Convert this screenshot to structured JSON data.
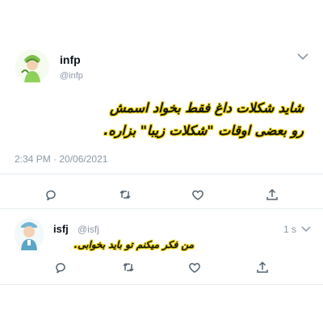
{
  "main_tweet": {
    "display_name": "infp",
    "handle": "@infp",
    "text_line1": "شاید شکلات داغ فقط بخواد اسمش",
    "text_line2": "رو بعضی اوقات \"شکلات زیبا\" بزاره.",
    "timestamp": "2:34 PM · 20/06/2021",
    "actions": [
      "reply-icon",
      "retweet-icon",
      "like-icon",
      "share-icon"
    ]
  },
  "reply_tweet": {
    "display_name": "isfj",
    "handle": "@isfj",
    "time_ago": "1 s",
    "text": "من فکر میکنم تو باید بخوابی.",
    "actions": [
      "reply-icon",
      "retweet-icon",
      "like-icon",
      "share-icon"
    ]
  },
  "colors": {
    "muted": "#8b98a5",
    "highlight": "#f0d000",
    "divider": "#e6ecf0"
  }
}
